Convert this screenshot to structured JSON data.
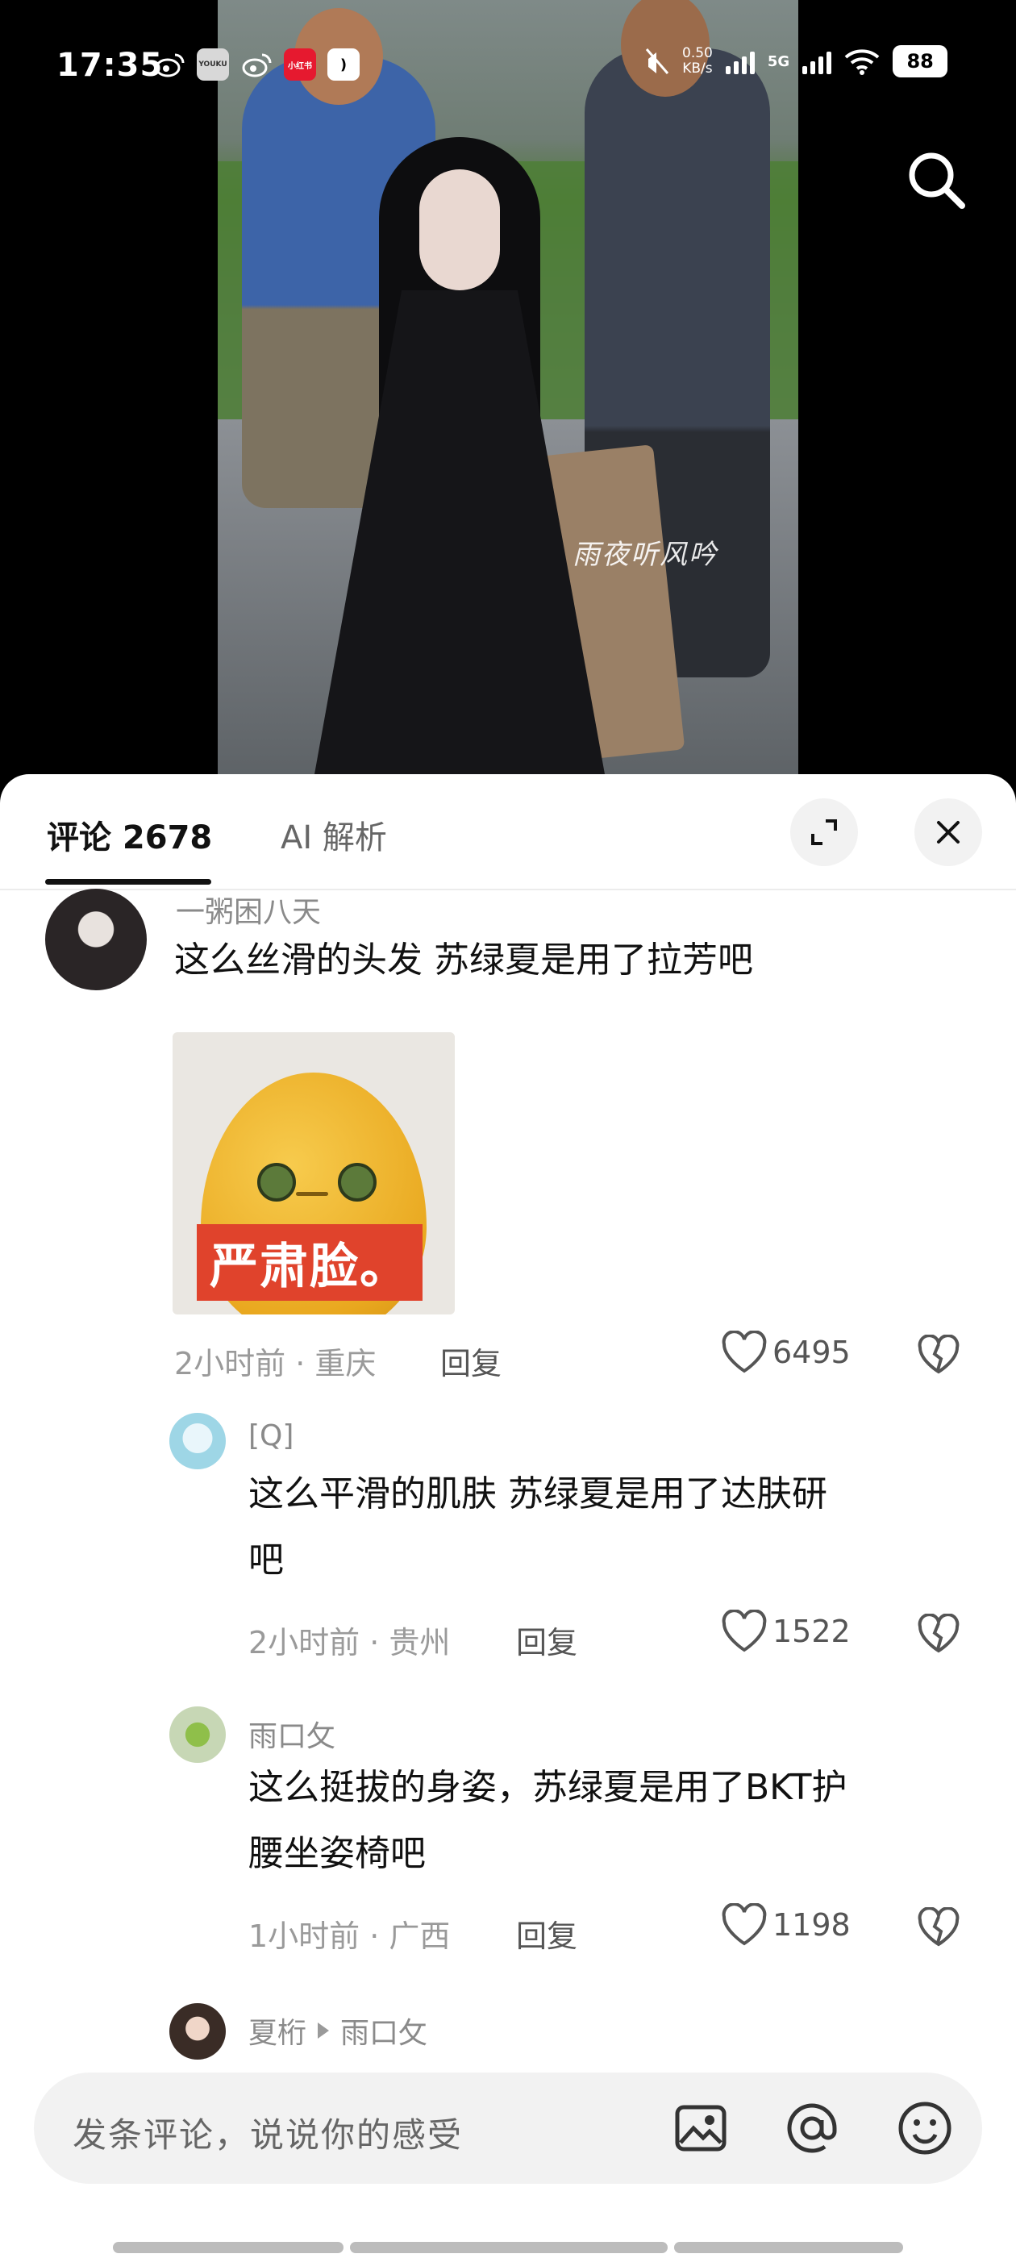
{
  "status_bar": {
    "time": "17:35",
    "notifications": [
      "weibo-icon",
      "youku-icon",
      "weibo-icon",
      "xiaohongshu-icon",
      "app-icon"
    ],
    "youku_label": "YOUKU",
    "xhs_label": "小红书",
    "white_app_label": ")",
    "network_speed_value": "0.50",
    "network_speed_unit": "KB/s",
    "signal_label": "5G",
    "battery": "88"
  },
  "video": {
    "watermark": "雨夜听风吟"
  },
  "comments_panel": {
    "tabs": [
      {
        "label": "评论 2678",
        "active": true
      },
      {
        "label": "AI 解析",
        "active": false
      }
    ],
    "comments": [
      {
        "username": "一粥困八天",
        "text": "这么丝滑的头发 苏绿夏是用了拉芳吧",
        "sticker_text": "严肃脸。",
        "meta": "2小时前 · 重庆",
        "reply_label": "回复",
        "likes": "6495"
      },
      {
        "username": "[Q]",
        "text_line1": "这么平滑的肌肤 苏绿夏是用了达肤研",
        "text_line2": "吧",
        "meta": "2小时前 · 贵州",
        "reply_label": "回复",
        "likes": "1522"
      },
      {
        "username": "雨口攵",
        "text_line1": "这么挺拔的身姿，苏绿夏是用了BKT护",
        "text_line2": "腰坐姿椅吧",
        "meta": "1小时前 · 广西",
        "reply_label": "回复",
        "likes": "1198"
      },
      {
        "username": "夏桁",
        "reply_to": "雨口攵"
      }
    ]
  },
  "input_bar": {
    "placeholder": "发条评论，说说你的感受"
  },
  "colors": {
    "sticker_label_bg": "#e0432c",
    "egg": "#f0b733"
  }
}
